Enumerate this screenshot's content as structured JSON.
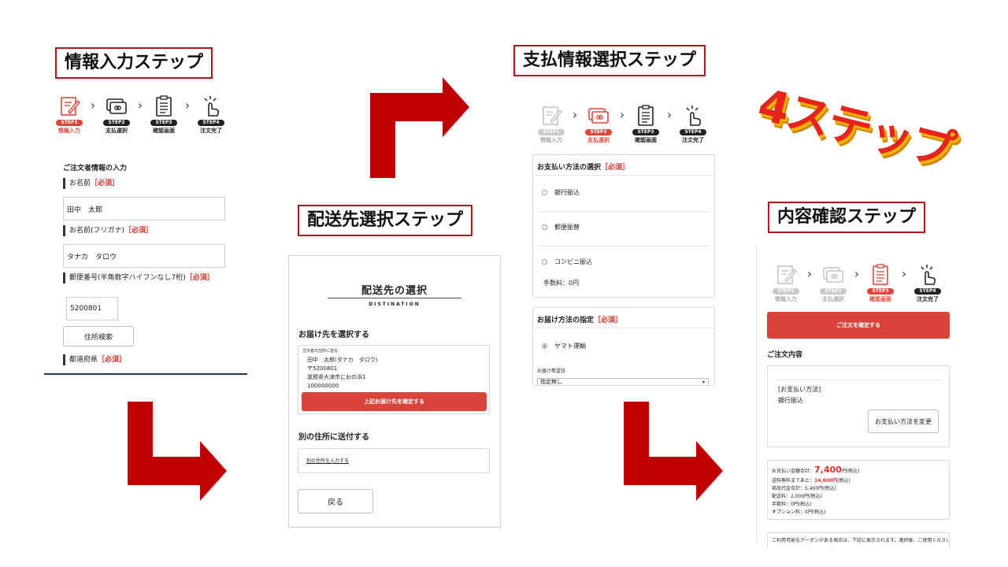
{
  "titles": {
    "step1": "情報入力ステップ",
    "step2": "配送先選択ステップ",
    "step3": "支払情報選択ステップ",
    "step4": "内容確認ステップ",
    "headline": "4ステップ"
  },
  "steps": [
    {
      "badge": "STEP1",
      "label": "情報入力"
    },
    {
      "badge": "STEP2",
      "label": "支払選択"
    },
    {
      "badge": "STEP3",
      "label": "確認画面"
    },
    {
      "badge": "STEP4",
      "label": "注文完了"
    }
  ],
  "info_input": {
    "section_title": "ご注文者情報の入力",
    "name_label": "お名前",
    "required": "［必須］",
    "name_value": "田中　太郎",
    "kana_label": "お名前(フリガナ)",
    "kana_value": "タナカ　タロウ",
    "postal_label": "郵便番号(半角数字ハイフンなし7桁)",
    "postal_value": "5200801",
    "address_search": "住所検索",
    "prefecture_label": "都道府県"
  },
  "destination": {
    "title": "配送先の選択",
    "subtitle": "DISTINATION",
    "select_heading": "お届け先を選択する",
    "box_caption": "注文者の住所に送る",
    "addr_name": "田中　太郎(タナカ　タロウ)",
    "addr_postal": "〒5200801",
    "addr_street": "滋賀県大津市におの浜1",
    "addr_phone": "100000000",
    "confirm_button": "上記お届け先を確定する",
    "other_heading": "別の住所に送付する",
    "other_link": "別の住所を入力する",
    "back_button": "戻る"
  },
  "payment": {
    "method_heading": "お支払い方法の選択",
    "required": "［必須］",
    "options": [
      "銀行振込",
      "郵便振替",
      "コンビニ振込"
    ],
    "fee": "手数料：0円",
    "delivery_heading": "お届け方法の指定",
    "carrier": "ヤマト運輸",
    "date_label": "お届け希望日",
    "date_value": "指定無し"
  },
  "confirm": {
    "confirm_button": "ご注文を確定する",
    "order_heading": "ご注文内容",
    "pay_method_label": "[お支払い方法]",
    "pay_method_value": "銀行振込",
    "change_button": "お支払い方法を変更",
    "total_label": "お支払い金額合計：",
    "total_value": "7,400",
    "total_unit": "円(税込)",
    "free_ship_pre": "送料無料まであと：",
    "free_ship_value": "14,600円",
    "free_ship_post": "(税込)",
    "line_goods": "商品代金合計：5,400円(税込)",
    "line_shipping": "配送料：2,000円(税込)",
    "line_fee": "手数料：0円(税込)",
    "line_option": "オプション料：0円(税込)",
    "coupon_note": "ご利用可能なクーポンがある場合は、下記に表示されます。選択後、ご使用ください。"
  },
  "colors": {
    "arrow": "#c00000",
    "accent": "#d9433a",
    "title_border": "#b3121b"
  }
}
